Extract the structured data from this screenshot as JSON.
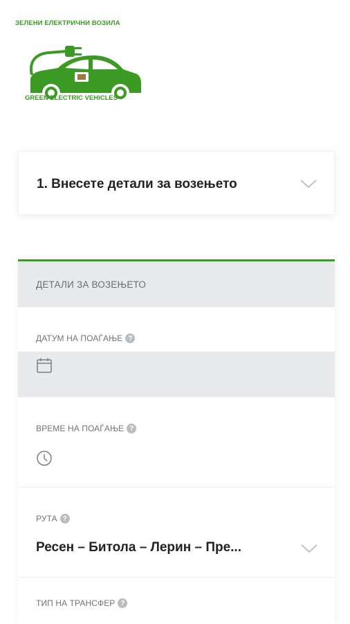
{
  "logo": {
    "top_text": "ЗЕЛЕНИ ЕЛЕКТРИЧНИ ВОЗИЛА",
    "bottom_text": "GREEN ELECTRIC VEHICLES",
    "brand_color": "#3a9a23"
  },
  "step": {
    "title": "1. Внесете детали за возењето",
    "icon": "chevron-down-icon"
  },
  "details": {
    "header": "ДЕТАЛИ ЗА ВОЗЕЊЕТО",
    "accent_color": "#3a9a23",
    "date": {
      "label": "ДАТУМ НА ПОАЃАЊЕ",
      "icon": "calendar-icon",
      "value": ""
    },
    "time": {
      "label": "ВРЕМЕ НА ПОАЃАЊЕ",
      "icon": "clock-icon",
      "value": ""
    },
    "route": {
      "label": "РУТА",
      "value": "Ресен – Битола – Лерин – Пре...",
      "icon": "chevron-down-icon"
    },
    "transfer_type": {
      "label": "ТИП НА ТРАНСФЕР"
    },
    "help_icon": "question-icon",
    "help_glyph": "?"
  }
}
